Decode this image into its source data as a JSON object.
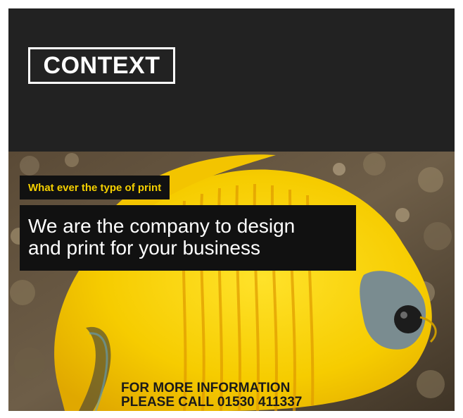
{
  "brand": {
    "logo_text": "CONTEXT"
  },
  "tagline": "What ever the type of print",
  "headline": {
    "line1": "We are the company to design",
    "line2": "and print for your business"
  },
  "cta": {
    "line1": "FOR MORE INFORMATION",
    "line2": "PLEASE CALL 01530 411337"
  },
  "image": {
    "subject": "yellow-butterflyfish-photo"
  },
  "colors": {
    "header_bg": "#222222",
    "tagline_text": "#f5d000",
    "headline_text": "#ffffff",
    "fish_yellow": "#f7d000",
    "cta_text": "#1a1a1a"
  }
}
